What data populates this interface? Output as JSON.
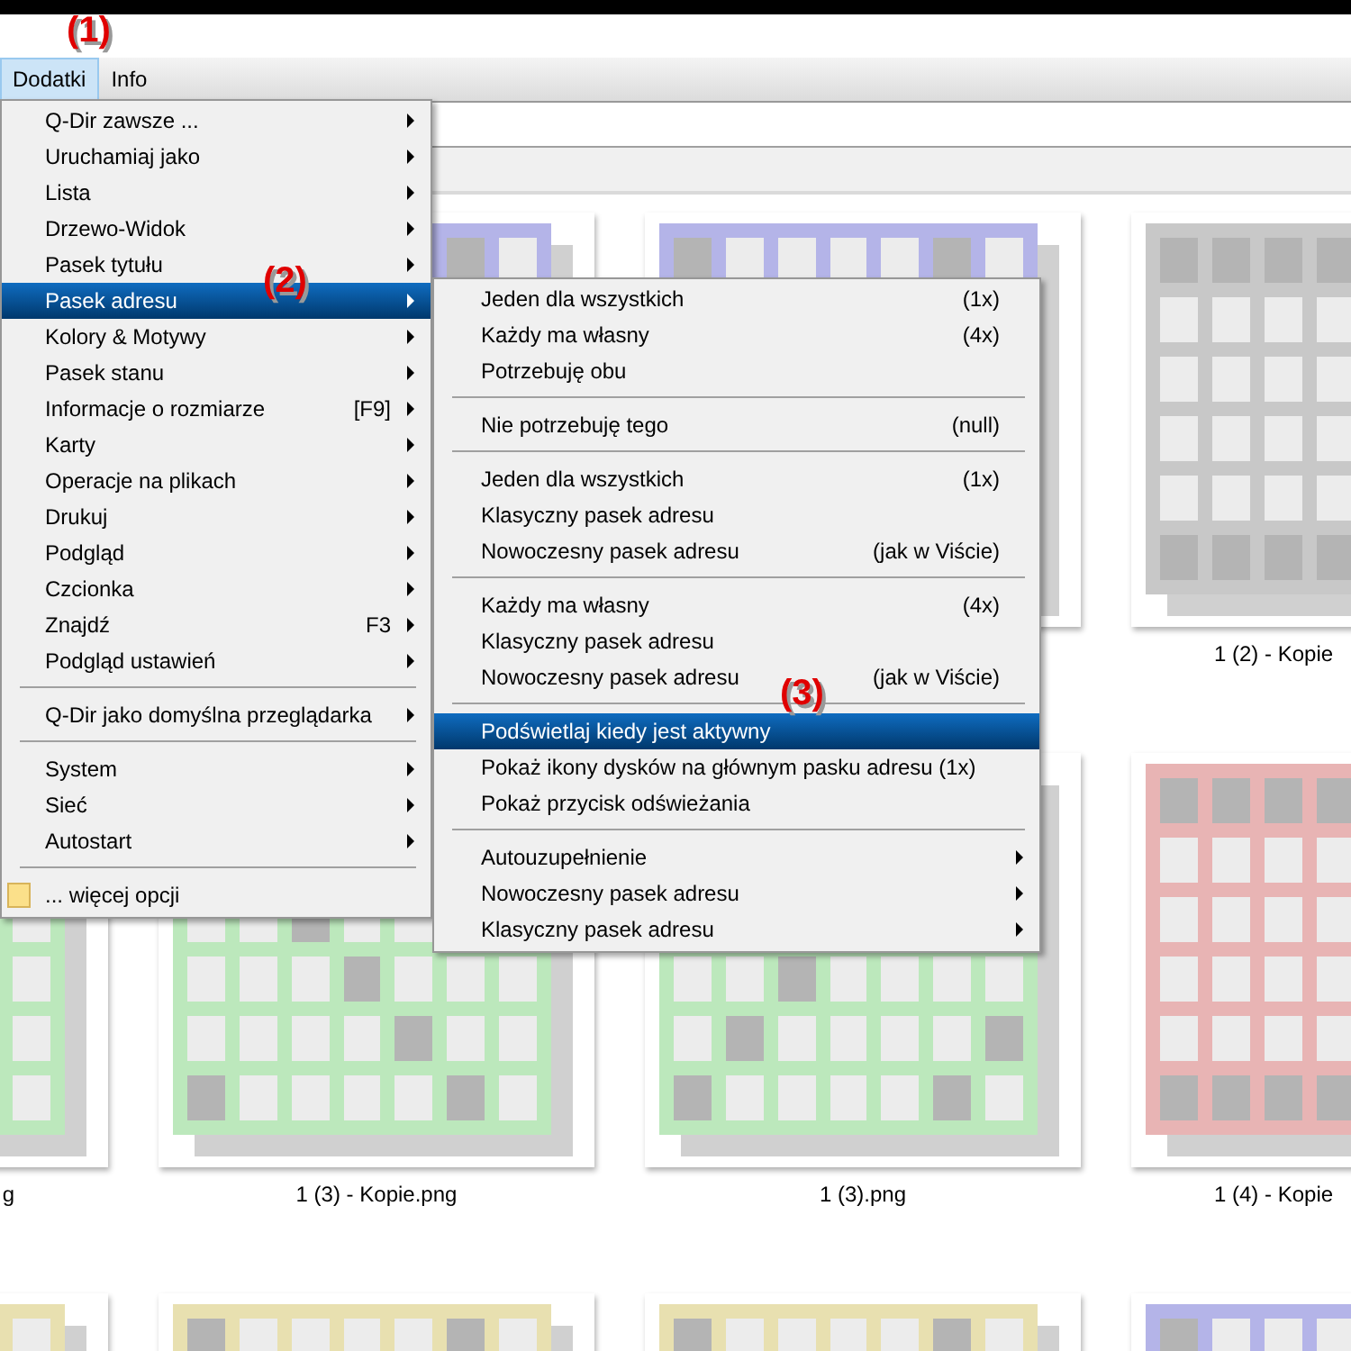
{
  "menu_bar": [
    {
      "label": "Dodatki",
      "selected": true,
      "marker": "(1)"
    },
    {
      "label": "Info",
      "selected": false
    }
  ],
  "menu": {
    "items": [
      {
        "kind": "item",
        "label": "Q-Dir zawsze ...",
        "submenu": true,
        "selected": false
      },
      {
        "kind": "item",
        "label": "Uruchamiaj jako",
        "submenu": true,
        "selected": false
      },
      {
        "kind": "item",
        "label": "Lista",
        "submenu": true,
        "selected": false
      },
      {
        "kind": "item",
        "label": "Drzewo-Widok",
        "submenu": true,
        "selected": false
      },
      {
        "kind": "item",
        "label": "Pasek tytułu",
        "submenu": true,
        "selected": false
      },
      {
        "kind": "item",
        "label": "Pasek adresu",
        "submenu": true,
        "selected": true,
        "marker": "(2)"
      },
      {
        "kind": "item",
        "label": "Kolory & Motywy",
        "submenu": true,
        "selected": false
      },
      {
        "kind": "item",
        "label": "Pasek stanu",
        "submenu": true,
        "selected": false
      },
      {
        "kind": "item",
        "label": "Informacje o rozmiarze",
        "shortcut": "[F9]",
        "submenu": true,
        "selected": false
      },
      {
        "kind": "item",
        "label": "Karty",
        "submenu": true,
        "selected": false
      },
      {
        "kind": "item",
        "label": "Operacje na plikach",
        "submenu": true,
        "selected": false
      },
      {
        "kind": "item",
        "label": "Drukuj",
        "submenu": true,
        "selected": false
      },
      {
        "kind": "item",
        "label": "Podgląd",
        "submenu": true,
        "selected": false
      },
      {
        "kind": "item",
        "label": "Czcionka",
        "submenu": true,
        "selected": false
      },
      {
        "kind": "item",
        "label": "Znajdź",
        "shortcut": "F3",
        "submenu": true,
        "selected": false
      },
      {
        "kind": "item",
        "label": "Podgląd ustawień",
        "submenu": true,
        "selected": false
      },
      {
        "kind": "separator"
      },
      {
        "kind": "item",
        "label": "Q-Dir jako domyślna przeglądarka",
        "submenu": true,
        "selected": false
      },
      {
        "kind": "separator"
      },
      {
        "kind": "item",
        "label": "System",
        "submenu": true,
        "selected": false
      },
      {
        "kind": "item",
        "label": "Sieć",
        "submenu": true,
        "selected": false
      },
      {
        "kind": "item",
        "label": "Autostart",
        "submenu": true,
        "selected": false
      },
      {
        "kind": "separator"
      },
      {
        "kind": "folder_item",
        "label": "... więcej opcji",
        "submenu": false,
        "selected": false
      }
    ]
  },
  "submenu": {
    "items": [
      {
        "kind": "item",
        "label": "Jeden dla wszystkich",
        "shortcut": "(1x)",
        "submenu": false,
        "selected": false
      },
      {
        "kind": "item",
        "label": "Każdy ma własny",
        "shortcut": "(4x)",
        "submenu": false,
        "selected": false
      },
      {
        "kind": "item",
        "label": "Potrzebuję obu",
        "submenu": false,
        "selected": false
      },
      {
        "kind": "separator"
      },
      {
        "kind": "item",
        "label": "Nie potrzebuję tego",
        "shortcut": "(null)",
        "submenu": false,
        "selected": false
      },
      {
        "kind": "separator"
      },
      {
        "kind": "item",
        "label": "Jeden dla wszystkich",
        "shortcut": "(1x)",
        "submenu": false,
        "selected": false
      },
      {
        "kind": "item",
        "label": "Klasyczny pasek adresu",
        "submenu": false,
        "selected": false
      },
      {
        "kind": "item",
        "label": "Nowoczesny pasek adresu",
        "shortcut": "(jak w Viście)",
        "submenu": false,
        "selected": false
      },
      {
        "kind": "separator"
      },
      {
        "kind": "item",
        "label": "Każdy ma własny",
        "shortcut": "(4x)",
        "submenu": false,
        "selected": false
      },
      {
        "kind": "item",
        "label": "Klasyczny pasek adresu",
        "submenu": false,
        "selected": false
      },
      {
        "kind": "item",
        "label": "Nowoczesny pasek adresu",
        "shortcut": "(jak w Viście)",
        "submenu": false,
        "selected": false
      },
      {
        "kind": "separator"
      },
      {
        "kind": "item",
        "label": "Podświetlaj kiedy jest aktywny",
        "submenu": false,
        "selected": true,
        "marker": "(3)"
      },
      {
        "kind": "item",
        "label": "Pokaż ikony dysków na głównym pasku adresu (1x)",
        "submenu": false,
        "selected": false
      },
      {
        "kind": "item",
        "label": "Pokaż przycisk odświeżania",
        "submenu": false,
        "selected": false
      },
      {
        "kind": "separator"
      },
      {
        "kind": "item",
        "label": "Autouzupełnienie",
        "submenu": true,
        "selected": false
      },
      {
        "kind": "item",
        "label": "Nowoczesny pasek adresu",
        "submenu": true,
        "selected": false
      },
      {
        "kind": "item",
        "label": "Klasyczny pasek adresu",
        "submenu": true,
        "selected": false
      }
    ]
  },
  "file_rows": [
    [
      {
        "color": "#b4b4e8"
      },
      {
        "color": "#b4b4e8"
      },
      {
        "color": "#c8c8c8",
        "label": "1 (2) - Kopie"
      }
    ],
    [
      {
        "color": "#bce8bc",
        "label": "g"
      },
      {
        "color": "#bce8bc",
        "label": "1 (3) - Kopie.png"
      },
      {
        "color": "#bce8bc",
        "label": "1 (3).png"
      },
      {
        "color": "#e8b4b4",
        "label": "1 (4) - Kopie"
      }
    ],
    [
      {
        "color": "#e8e0b0"
      },
      {
        "color": "#e8e0b0"
      },
      {
        "color": "#e8e0b0"
      },
      {
        "color": "#b4b4e8"
      }
    ]
  ]
}
